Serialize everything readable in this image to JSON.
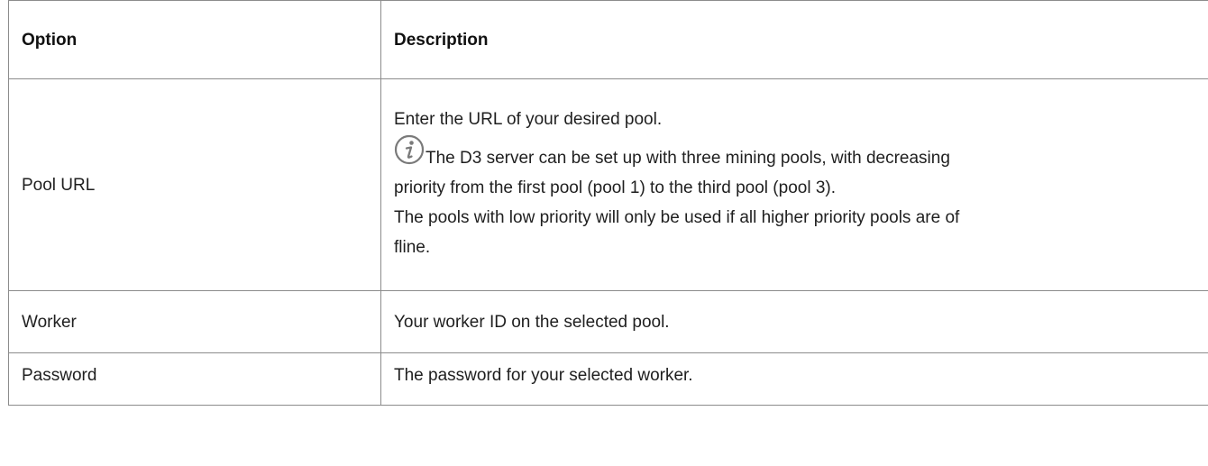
{
  "table": {
    "headers": {
      "option": "Option",
      "description": "Description"
    },
    "rows": [
      {
        "option": "Pool URL",
        "description": {
          "line1": "Enter the URL of your desired pool.",
          "info_icon": "info-icon",
          "note_a": "The D3 server can be set up with three mining pools, with decreasing",
          "note_b": "priority from the first pool (pool 1) to the third pool (pool 3).",
          "note_c": "The pools with low priority will only be used if all higher priority pools are of",
          "note_d": "fline."
        }
      },
      {
        "option": "Worker",
        "description": "Your worker ID on the selected pool."
      },
      {
        "option": "Password",
        "description": "The password for your selected worker."
      }
    ]
  },
  "colors": {
    "border": "#8c8c8c",
    "text": "#1f1f1f",
    "icon": "#7a7a7a"
  }
}
